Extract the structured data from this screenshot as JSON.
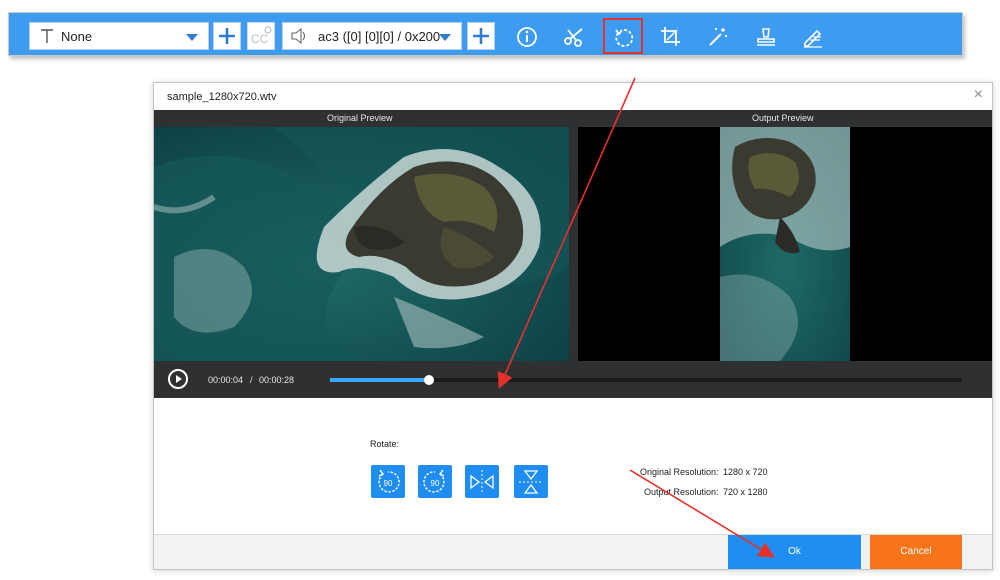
{
  "toolbar": {
    "subtitle_value": "None",
    "audio_value": "ac3 ([0] [0][0] / 0x200",
    "icons": [
      "text-icon",
      "add-subtitle-icon",
      "cc-settings-icon",
      "speaker-icon",
      "add-audio-icon",
      "info-icon",
      "scissors-icon",
      "rotate-icon",
      "crop-icon",
      "magic-wand-icon",
      "stamp-icon",
      "edit-icon"
    ],
    "accent": "#3d9bf0",
    "highlight": "#e0322e"
  },
  "dialog": {
    "title": "sample_1280x720.wtv",
    "close_glyph": "×",
    "original_label": "Original Preview",
    "output_label": "Output Preview",
    "current_time": "00:00:04",
    "time_separator": "/",
    "total_time": "00:00:28",
    "progress": 0.157,
    "rotate_label": "Rotate:",
    "rotate_buttons": [
      {
        "name": "rotate-left-90-icon",
        "text": "90"
      },
      {
        "name": "rotate-right-90-icon",
        "text": "90"
      },
      {
        "name": "flip-horizontal-icon"
      },
      {
        "name": "flip-vertical-icon"
      }
    ],
    "original_resolution_label": "Original Resolution:",
    "original_resolution_value": "1280 x 720",
    "output_resolution_label": "Output Resolution:",
    "output_resolution_value": "720 x 1280",
    "ok_label": "Ok",
    "cancel_label": "Cancel",
    "ok_color": "#1f8ef0",
    "cancel_color": "#f7741a"
  }
}
